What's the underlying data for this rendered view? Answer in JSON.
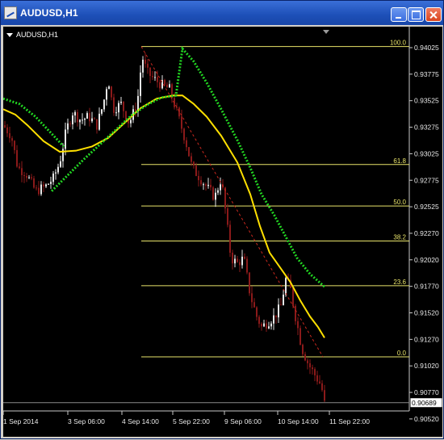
{
  "window": {
    "title": "AUDUSD,H1",
    "icon": "chart-window-icon",
    "buttons": [
      "minimize",
      "maximize",
      "close"
    ]
  },
  "chart_header": "AUDUSD,H1",
  "chart_data": {
    "type": "candlestick",
    "symbol": "AUDUSD",
    "timeframe": "H1",
    "x_ticks": [
      "1 Sep 2014",
      "3 Sep 06:00",
      "4 Sep 14:00",
      "5 Sep 22:00",
      "9 Sep 06:00",
      "10 Sep 14:00",
      "11 Sep 22:00"
    ],
    "y_ticks": [
      "0.94025",
      "0.93775",
      "0.93525",
      "0.93275",
      "0.93025",
      "0.92775",
      "0.92525",
      "0.92270",
      "0.92020",
      "0.91770",
      "0.91520",
      "0.91270",
      "0.91020",
      "0.90770",
      "0.90520"
    ],
    "current_price": "0.90689",
    "ylim": [
      0.9045,
      0.9415
    ],
    "fibonacci": {
      "levels": [
        {
          "label": "100.0",
          "price": 0.9404
        },
        {
          "label": "61.8",
          "price": 0.9293
        },
        {
          "label": "50.0",
          "price": 0.9254
        },
        {
          "label": "38.2",
          "price": 0.9221
        },
        {
          "label": "23.6",
          "price": 0.9179
        },
        {
          "label": "0.0",
          "price": 0.9112
        }
      ],
      "color": "#e8e36a"
    },
    "bull_color": "#e6e6e6",
    "bear_color": "#8b1a1a",
    "yellow_ma_color": "#ffe000",
    "green_ma_color": "#22d422",
    "trendline_color": "#c8281e",
    "grid": false
  }
}
